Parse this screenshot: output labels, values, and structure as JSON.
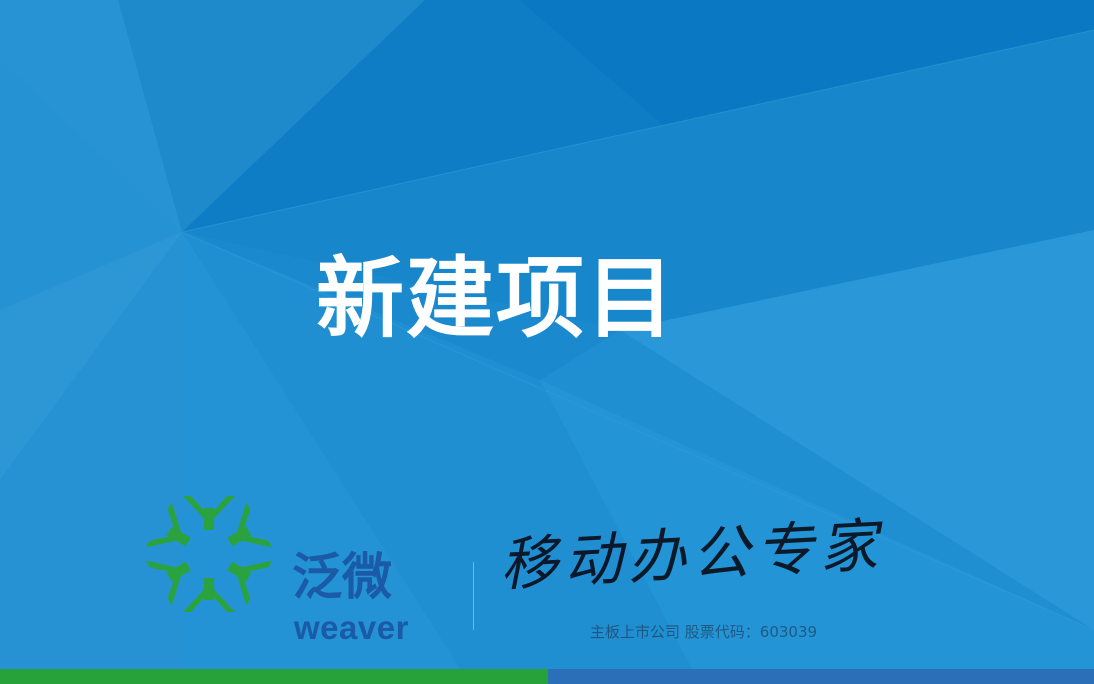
{
  "slide": {
    "title": "新建项目"
  },
  "brand": {
    "name_cn": "泛微",
    "name_en": "weaver",
    "slogan": "移动办公专家",
    "stock_info": "主板上市公司   股票代码：603039"
  },
  "icons": {
    "logo": "weaver-snowflake-logo-icon"
  },
  "colors": {
    "background": "#1f8fd2",
    "title": "#ffffff",
    "brand_blue": "#1a5aa6",
    "logo_green": "#2aa33f",
    "footer_green": "#27a23a",
    "footer_blue": "#2c6fb9"
  }
}
